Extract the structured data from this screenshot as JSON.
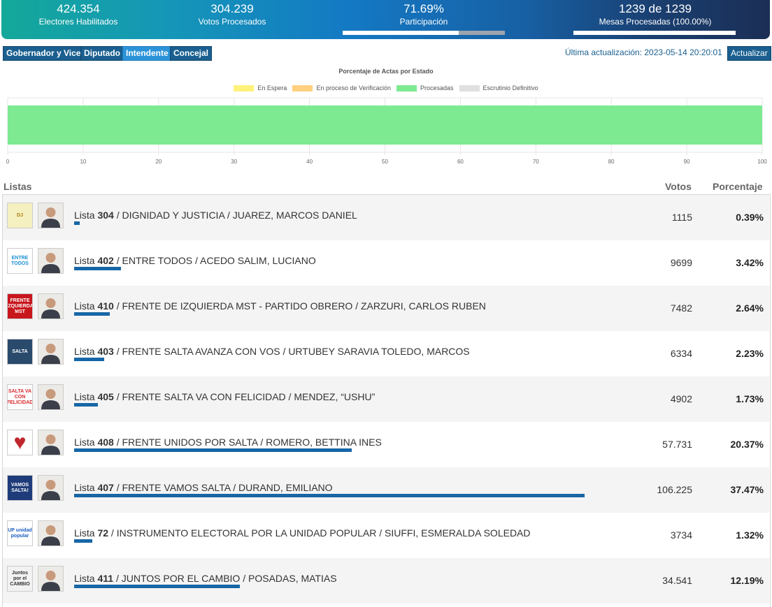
{
  "header": {
    "stats": [
      {
        "value": "424.354",
        "label": "Electores Habilitados"
      },
      {
        "value": "304.239",
        "label": "Votos Procesados"
      },
      {
        "value": "71.69%",
        "label": "Participación",
        "progress": 0.7169
      },
      {
        "value": "1239 de 1239",
        "label": "Mesas Procesadas (100.00%)",
        "progress": 1.0
      }
    ]
  },
  "tabs": [
    "Gobernador y Vice",
    "Diputado",
    "Intendente",
    "Concejal"
  ],
  "active_tab": "Intendente",
  "last_update": "Última actualización: 2023-05-14 20:20:01",
  "refresh_label": "Actualizar",
  "chart_data": {
    "type": "bar",
    "orientation": "horizontal",
    "stacked": true,
    "title": "Porcentaje de Actas por Estado",
    "categories": [
      ""
    ],
    "series": [
      {
        "name": "En Espera",
        "values": [
          0
        ],
        "color": "#fff27a"
      },
      {
        "name": "En proceso de Verificación",
        "values": [
          0
        ],
        "color": "#ffd080"
      },
      {
        "name": "Procesadas",
        "values": [
          100
        ],
        "color": "#7dea92"
      },
      {
        "name": "Escrutinio Definitivo",
        "values": [
          0
        ],
        "color": "#e0e0e0"
      }
    ],
    "xlim": [
      0,
      100
    ],
    "xticks": [
      "0",
      "10",
      "20",
      "30",
      "40",
      "50",
      "60",
      "70",
      "80",
      "90",
      "100"
    ],
    "legend_position": "top",
    "grid": true
  },
  "results": {
    "headers": {
      "lists": "Listas",
      "votes": "Votos",
      "percent": "Porcentaje"
    },
    "list_prefix": "Lista",
    "rows": [
      {
        "number": "304",
        "party": "DIGNIDAD Y JUSTICIA",
        "candidate": "JUAREZ, MARCOS DANIEL",
        "votes": "1115",
        "percent": "0.39%",
        "share": 0.39,
        "logo_color": "#f5f0c0",
        "logo_text": "DJ",
        "logo_fg": "#b07a12"
      },
      {
        "number": "402",
        "party": "ENTRE TODOS",
        "candidate": "ACEDO SALIM, LUCIANO",
        "votes": "9699",
        "percent": "3.42%",
        "share": 3.42,
        "logo_color": "#ffffff",
        "logo_text": "ENTRE TODOS",
        "logo_fg": "#1b8fd6"
      },
      {
        "number": "410",
        "party": "FRENTE DE IZQUIERDA MST - PARTIDO OBRERO",
        "candidate": "ZARZURI, CARLOS RUBEN",
        "votes": "7482",
        "percent": "2.64%",
        "share": 2.64,
        "logo_color": "#c8161d",
        "logo_text": "FRENTE IZQUIERDA MST",
        "logo_fg": "#ffffff"
      },
      {
        "number": "403",
        "party": "FRENTE SALTA AVANZA CON VOS",
        "candidate": "URTUBEY SARAVIA TOLEDO, MARCOS",
        "votes": "6334",
        "percent": "2.23%",
        "share": 2.23,
        "logo_color": "#2a4a6c",
        "logo_text": "SALTA",
        "logo_fg": "#ffffff"
      },
      {
        "number": "405",
        "party": "FRENTE SALTA VA CON FELICIDAD",
        "candidate": "MENDEZ, “USHU”",
        "votes": "4902",
        "percent": "1.73%",
        "share": 1.73,
        "logo_color": "#ffffff",
        "logo_text": "SALTA VA CON FELICIDAD",
        "logo_fg": "#d9262b"
      },
      {
        "number": "408",
        "party": "FRENTE UNIDOS POR SALTA",
        "candidate": "ROMERO, BETTINA INES",
        "votes": "57.731",
        "percent": "20.37%",
        "share": 20.37,
        "logo_color": "#ffffff",
        "logo_text": "♥",
        "logo_fg": "#c0262d"
      },
      {
        "number": "407",
        "party": "FRENTE VAMOS SALTA",
        "candidate": "DURAND, EMILIANO",
        "votes": "106.225",
        "percent": "37.47%",
        "share": 37.47,
        "logo_color": "#1f3c7a",
        "logo_text": "VAMOS SALTA!",
        "logo_fg": "#ffffff"
      },
      {
        "number": "72",
        "party": "INSTRUMENTO ELECTORAL POR LA UNIDAD POPULAR",
        "candidate": "SIUFFI, ESMERALDA SOLEDAD",
        "votes": "3734",
        "percent": "1.32%",
        "share": 1.32,
        "logo_color": "#ffffff",
        "logo_text": "UP unidad popular",
        "logo_fg": "#1d5fbf"
      },
      {
        "number": "411",
        "party": "JUNTOS POR EL CAMBIO",
        "candidate": "POSADAS, MATIAS",
        "votes": "34.541",
        "percent": "12.19%",
        "share": 12.19,
        "logo_color": "#f2f2f2",
        "logo_text": "Juntos por el CAMBIO",
        "logo_fg": "#333333"
      }
    ]
  }
}
